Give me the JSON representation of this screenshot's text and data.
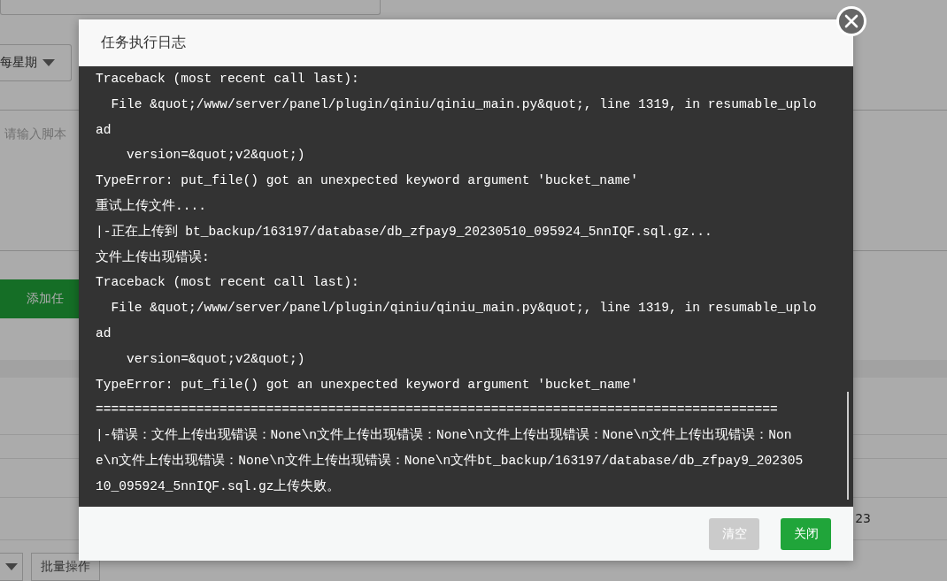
{
  "background": {
    "period_select": "每星期",
    "script_placeholder": "请输入脚本",
    "add_button": "添加任",
    "row_cell": "23",
    "batch_button": "批量操作"
  },
  "dialog": {
    "title": "任务执行日志",
    "log_lines": [
      "Traceback (most recent call last):",
      "  File &quot;/www/server/panel/plugin/qiniu/qiniu_main.py&quot;, line 1319, in resumable_uplo",
      "ad",
      "    version=&quot;v2&quot;)",
      "TypeError: put_file() got an unexpected keyword argument 'bucket_name'",
      "重试上传文件....",
      "|-正在上传到 bt_backup/163197/database/db_zfpay9_20230510_095924_5nnIQF.sql.gz...",
      "文件上传出现错误:",
      "Traceback (most recent call last):",
      "  File &quot;/www/server/panel/plugin/qiniu/qiniu_main.py&quot;, line 1319, in resumable_uplo",
      "ad",
      "    version=&quot;v2&quot;)",
      "TypeError: put_file() got an unexpected keyword argument 'bucket_name'",
      "========================================================================================",
      "|-错误：文件上传出现错误：None\\n文件上传出现错误：None\\n文件上传出现错误：None\\n文件上传出现错误：Non",
      "e\\n文件上传出现错误：None\\n文件上传出现错误：None\\n文件bt_backup/163197/database/db_zfpay9_202305",
      "10_095924_5nnIQF.sql.gz上传失败。"
    ],
    "buttons": [
      {
        "label": "清空",
        "kind": "secondary"
      },
      {
        "label": "关闭",
        "kind": "primary"
      }
    ]
  }
}
